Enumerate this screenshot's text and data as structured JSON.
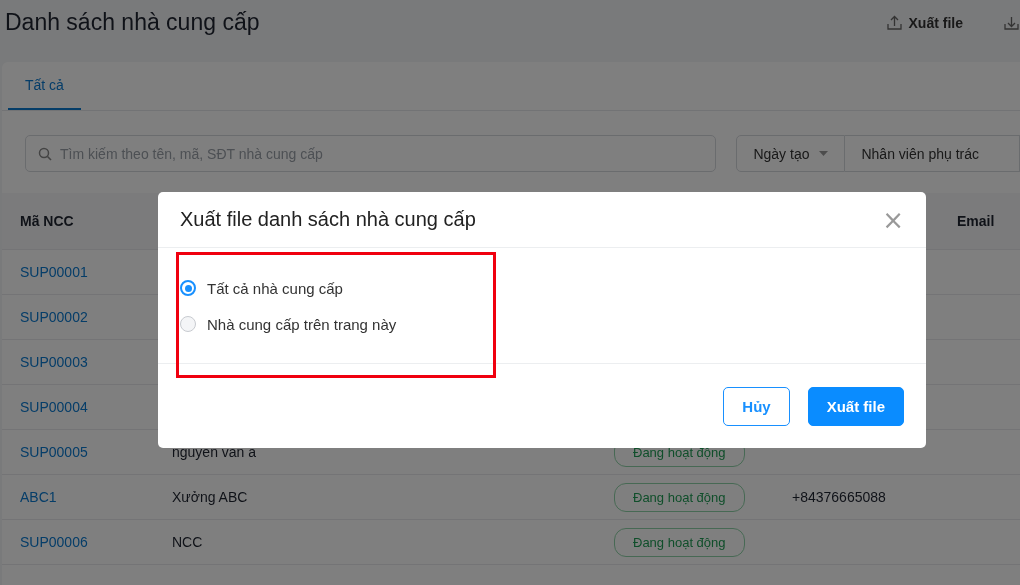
{
  "header": {
    "title": "Danh sách nhà cung cấp",
    "export_button": "Xuất file"
  },
  "tabs": [
    {
      "label": "Tất cả",
      "selected": true
    }
  ],
  "search": {
    "placeholder": "Tìm kiếm theo tên, mã, SĐT nhà cung cấp"
  },
  "filters": [
    {
      "label": "Ngày tạo",
      "kind": "dropdown"
    },
    {
      "label": "Nhân viên phụ trác",
      "kind": "plain"
    }
  ],
  "table": {
    "columns": [
      {
        "label": "Mã NCC"
      },
      {
        "label": "Email"
      }
    ],
    "rows": [
      {
        "code": "SUP00001"
      },
      {
        "code": "SUP00002"
      },
      {
        "code": "SUP00003"
      },
      {
        "code": "SUP00004"
      },
      {
        "code": "SUP00005",
        "name": "nguyen van a",
        "status": "Đang hoạt động"
      },
      {
        "code": "ABC1",
        "name": "Xưởng ABC",
        "status": "Đang hoạt động",
        "phone": "+84376665088"
      },
      {
        "code": "SUP00006",
        "name": "NCC",
        "status": "Đang hoạt động"
      }
    ]
  },
  "dialog": {
    "title": "Xuất file danh sách nhà cung cấp",
    "close": "×",
    "options": [
      {
        "label": "Tất cả nhà cung cấp",
        "selected": true
      },
      {
        "label": "Nhà cung cấp trên trang này",
        "selected": false
      }
    ],
    "highlighted": true,
    "buttons": [
      {
        "label": "Hủy",
        "kind": "secondary"
      },
      {
        "label": "Xuất file",
        "kind": "primary"
      }
    ]
  }
}
